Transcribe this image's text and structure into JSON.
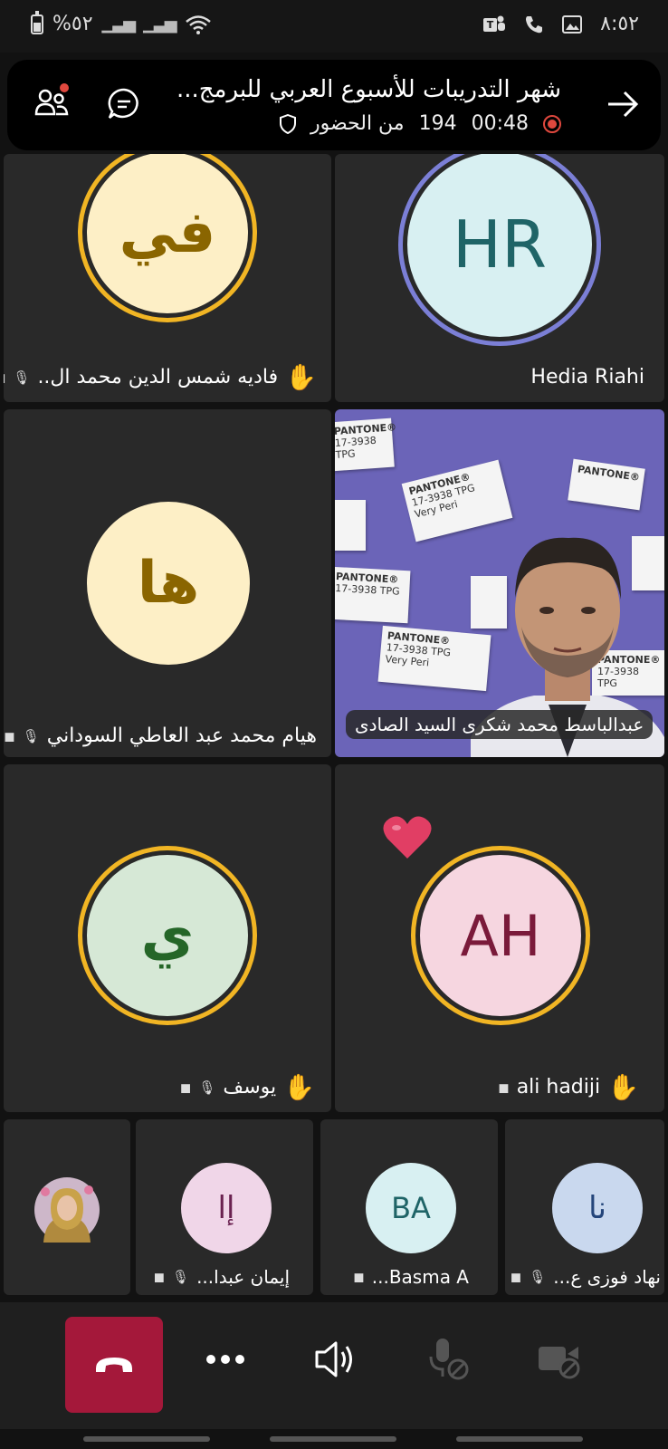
{
  "status_bar": {
    "battery_text": "%٥٢",
    "time": "٨:٥٢",
    "icons": [
      "battery-icon",
      "signal-icon",
      "signal-icon",
      "wifi-icon",
      "teams-icon",
      "phone-icon",
      "image-icon"
    ]
  },
  "meeting": {
    "title": "شهر التدريبات للأسبوع العربي للبرمج...",
    "elapsed": "00:48",
    "attendees_count": "194",
    "attendees_label": "من الحضور",
    "record_color": "#e0483e"
  },
  "tiles": [
    {
      "initials": "في",
      "name": "فاديه شمس الدين محمد ال..",
      "hand_raised": true,
      "avatar_bg": "#fdefc6",
      "text_color": "#8a6500",
      "ring": "#f1b524"
    },
    {
      "initials": "HR",
      "name": "Hedia Riahi",
      "hand_raised": false,
      "avatar_bg": "#d8f0f2",
      "text_color": "#1f6467",
      "ring": "#7b7fd6"
    },
    {
      "initials": "ها",
      "name": "هيام محمد عبد العاطي السوداني",
      "hand_raised": false,
      "avatar_bg": "#fdefc6",
      "text_color": "#8a6500"
    },
    {
      "name": "عبدالباسط محمد شكرى السيد الصادى",
      "video": true
    },
    {
      "initials": "ي",
      "name": "يوسف",
      "hand_raised": true,
      "avatar_bg": "#d6e8d6",
      "text_color": "#256628",
      "ring": "#f1b524"
    },
    {
      "initials": "AH",
      "name": "ali hadiji",
      "hand_raised": true,
      "avatar_bg": "#f6d6e0",
      "text_color": "#7a1a3a",
      "ring": "#f1b524",
      "reaction": "heart"
    }
  ],
  "bottom_tiles": [
    {
      "photo": true
    },
    {
      "initials": "إا",
      "name": "إيمان عبدا...",
      "avatar_bg": "#f0d6e8",
      "text_color": "#6a2250"
    },
    {
      "initials": "BA",
      "name": "Basma A...",
      "avatar_bg": "#d8f0f2",
      "text_color": "#1f6467"
    },
    {
      "initials": "نا",
      "name": "نهاد فوزى ع...",
      "avatar_bg": "#c9d8ee",
      "text_color": "#24457a"
    }
  ],
  "video_cards": [
    {
      "brand": "PANTONE®",
      "code": "17-3938 TPG",
      "name": "Very Peri"
    }
  ],
  "controls": {
    "hangup_color": "#a4183a"
  }
}
